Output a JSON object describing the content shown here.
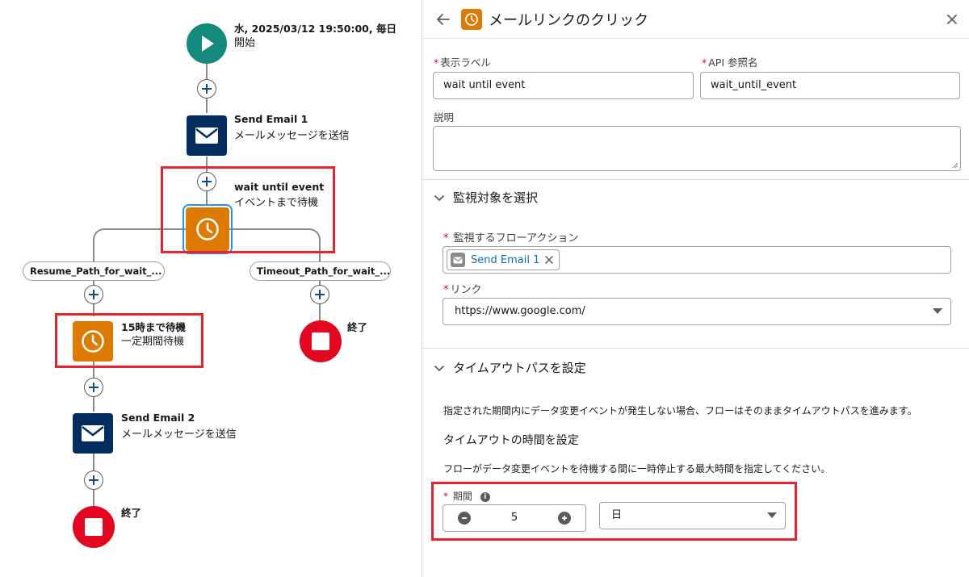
{
  "flow": {
    "start": {
      "title": "水, 2025/03/12 19:50:00, 毎日",
      "subtitle": "開始"
    },
    "send_email_1": {
      "title": "Send Email 1",
      "subtitle": "メールメッセージを送信"
    },
    "wait_until_event": {
      "title": "wait until event",
      "subtitle": "イベントまで待機"
    },
    "resume_path_label": "Resume_Path_for_wait_...",
    "timeout_path_label": "Timeout_Path_for_wait_...",
    "wait_15": {
      "title": "15時まで待機",
      "subtitle": "一定期間待機"
    },
    "send_email_2": {
      "title": "Send Email 2",
      "subtitle": "メールメッセージを送信"
    },
    "end_label": "終了",
    "end_label_right": "終了"
  },
  "panel": {
    "title": "メールリンクのクリック",
    "display_label": {
      "label": "表示ラベル",
      "value": "wait until event"
    },
    "api_name": {
      "label": "API 参照名",
      "value": "wait_until_event"
    },
    "description": {
      "label": "説明",
      "value": ""
    },
    "section_monitor": {
      "title": "監視対象を選択",
      "flow_action_label": "監視するフローアクション",
      "flow_action_chip": "Send Email 1",
      "link_label": "リンク",
      "link_value": "https://www.google.com/"
    },
    "section_timeout": {
      "title": "タイムアウトパスを設定",
      "desc": "指定された期間内にデータ変更イベントが発生しない場合、フローはそのままタイムアウトパスを進みます。",
      "subheading": "タイムアウトの時間を設定",
      "helper": "フローがデータ変更イベントを待機する間に一時停止する最大時間を指定してください。",
      "period_label": "期間",
      "period_value": "5",
      "unit_value": "日"
    }
  },
  "colors": {
    "start": "#14897d",
    "email_tile": "#032d60",
    "wait_tile": "#dd7a01",
    "end": "#e4061e",
    "highlight": "#e8222e",
    "link": "#0b6fb6"
  },
  "icons": [
    "play-icon",
    "envelope-icon",
    "clock-icon",
    "stop-icon",
    "plus-icon",
    "back-arrow-icon",
    "close-icon",
    "chevron-down-icon",
    "info-icon",
    "minus-icon"
  ]
}
